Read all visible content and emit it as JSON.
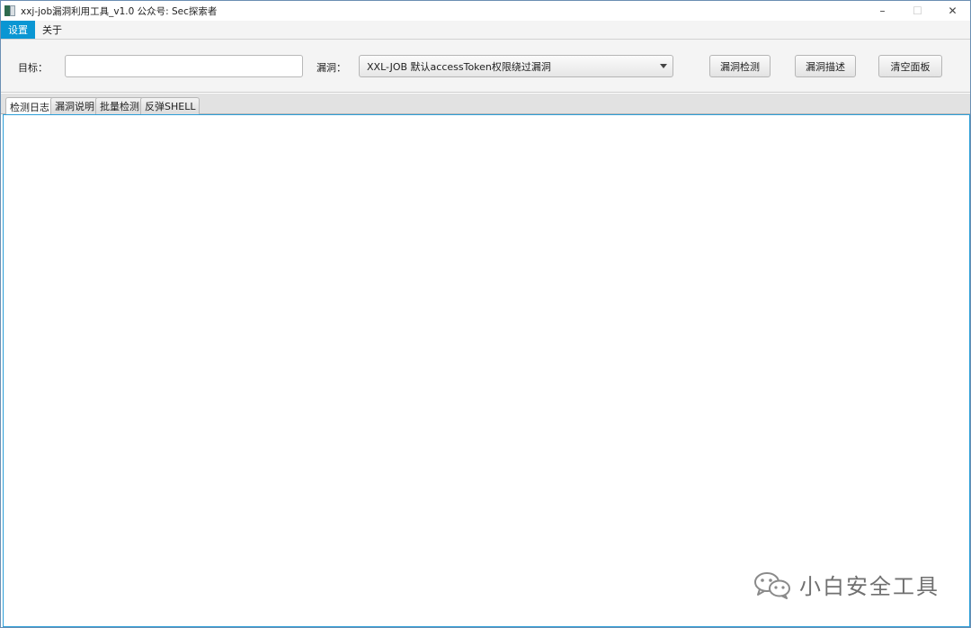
{
  "window": {
    "title": "xxj-job漏洞利用工具_v1.0  公众号: Sec探索者",
    "controls": {
      "minimize": "–",
      "maximize": "☐",
      "close": "✕"
    }
  },
  "menubar": {
    "items": [
      {
        "label": "设置",
        "active": true
      },
      {
        "label": "关于",
        "active": false
      }
    ]
  },
  "toolbar": {
    "target_label": "目标：",
    "target_value": "",
    "target_placeholder": "",
    "vuln_label": "漏洞：",
    "vuln_selected": "XXL-JOB 默认accessToken权限绕过漏洞",
    "detect_button": "漏洞检测",
    "describe_button": "漏洞描述",
    "clear_button": "清空面板"
  },
  "tabs": [
    {
      "label": "检测日志",
      "selected": true
    },
    {
      "label": "漏洞说明",
      "selected": false
    },
    {
      "label": "批量检测",
      "selected": false
    },
    {
      "label": "反弹SHELL",
      "selected": false
    }
  ],
  "watermark": {
    "text": "小白安全工具",
    "icon": "wechat-icon"
  },
  "colors": {
    "accent": "#0a96d3",
    "content_border": "#2e9fd8"
  }
}
